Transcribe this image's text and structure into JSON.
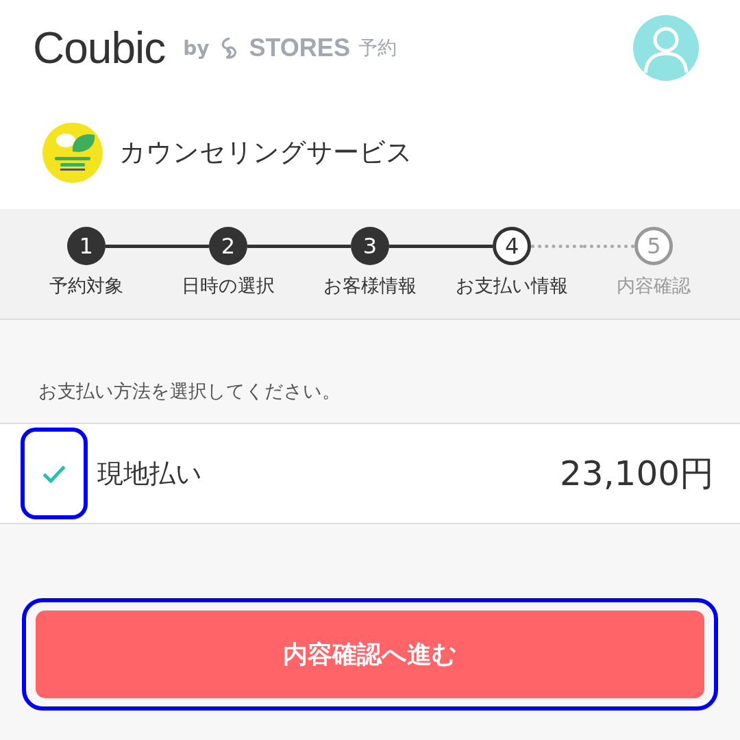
{
  "header": {
    "brand": "Coubic",
    "by": "by",
    "partner": "STORES",
    "partner_suffix": "予約"
  },
  "shop": {
    "name": "カウンセリングサービス"
  },
  "steps": [
    {
      "number": "1",
      "label": "予約対象",
      "kind": "done"
    },
    {
      "number": "2",
      "label": "日時の選択",
      "kind": "done"
    },
    {
      "number": "3",
      "label": "お客様情報",
      "kind": "done"
    },
    {
      "number": "4",
      "label": "お支払い情報",
      "kind": "current"
    },
    {
      "number": "5",
      "label": "内容確認",
      "kind": "upcoming"
    }
  ],
  "prompt": "お支払い方法を選択してください。",
  "payment_options": [
    {
      "label": "現地払い",
      "price": "23,100円",
      "selected": true,
      "highlighted": true
    }
  ],
  "next_button": {
    "label": "内容確認へ進む",
    "highlighted": true
  }
}
